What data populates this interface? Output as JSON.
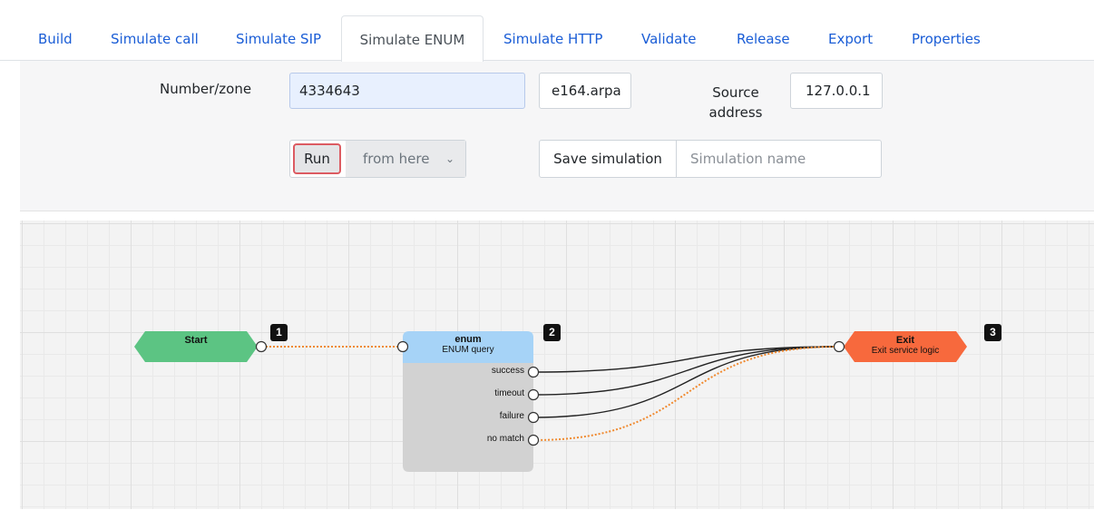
{
  "tabs": [
    {
      "label": "Build",
      "active": false
    },
    {
      "label": "Simulate call",
      "active": false
    },
    {
      "label": "Simulate SIP",
      "active": false
    },
    {
      "label": "Simulate ENUM",
      "active": true
    },
    {
      "label": "Simulate HTTP",
      "active": false
    },
    {
      "label": "Validate",
      "active": false
    },
    {
      "label": "Release",
      "active": false
    },
    {
      "label": "Export",
      "active": false
    },
    {
      "label": "Properties",
      "active": false
    }
  ],
  "form": {
    "number_label": "Number/zone",
    "number_value": "4334643",
    "zone_value": "e164.arpa",
    "source_label_line1": "Source",
    "source_label_line2": "address",
    "source_value": "127.0.0.1",
    "run_label": "Run",
    "from_select": "from here",
    "save_label": "Save simulation",
    "simulation_name_placeholder": "Simulation name"
  },
  "flow": {
    "colors": {
      "start": "#5cc483",
      "enum_header": "#a6d3f7",
      "enum_body": "#d2d2d2",
      "exit": "#f7693d",
      "active_link": "#f08a30",
      "idle_link": "#222222"
    },
    "start": {
      "title": "Start",
      "badge": "1"
    },
    "enum": {
      "title": "enum",
      "subtitle": "ENUM query",
      "badge": "2",
      "outputs": [
        "success",
        "timeout",
        "failure",
        "no match"
      ]
    },
    "exit": {
      "title": "Exit",
      "subtitle": "Exit service logic",
      "badge": "3"
    }
  }
}
